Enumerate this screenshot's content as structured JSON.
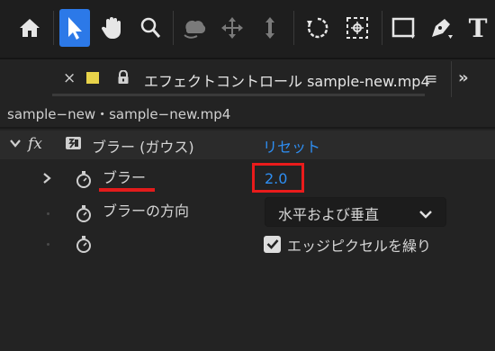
{
  "toolbar": {
    "tools": [
      "home-icon",
      "selection-icon",
      "hand-icon",
      "zoom-icon",
      "orbit-icon",
      "pan-icon",
      "dolly-icon",
      "rotate-icon",
      "anchor-icon",
      "rectangle-icon",
      "pen-icon",
      "text-icon"
    ],
    "active_tool": "selection-icon",
    "accent": "#2c79e8",
    "text_tool_label": "T"
  },
  "tab": {
    "close_glyph": "×",
    "title": "エフェクトコントロール sample-new.mp4",
    "menu_glyph": "≡",
    "overflow_glyph": "»",
    "swatch_color": "#e8d34a"
  },
  "breadcrumb": "sample−new・sample−new.mp4",
  "effect": {
    "fx_label": "fx",
    "name": "ブラー (ガウス)",
    "reset_label": "リセット",
    "properties": {
      "blurriness_label": "ブラー",
      "blurriness_value": "2.0",
      "direction_label": "ブラーの方向",
      "direction_value": "水平および垂直",
      "repeat_edge_label": "エッジピクセルを繰り",
      "repeat_edge_checked": true
    }
  },
  "highlight_color": "#ea1b1b",
  "link_color": "#2e8ef2"
}
